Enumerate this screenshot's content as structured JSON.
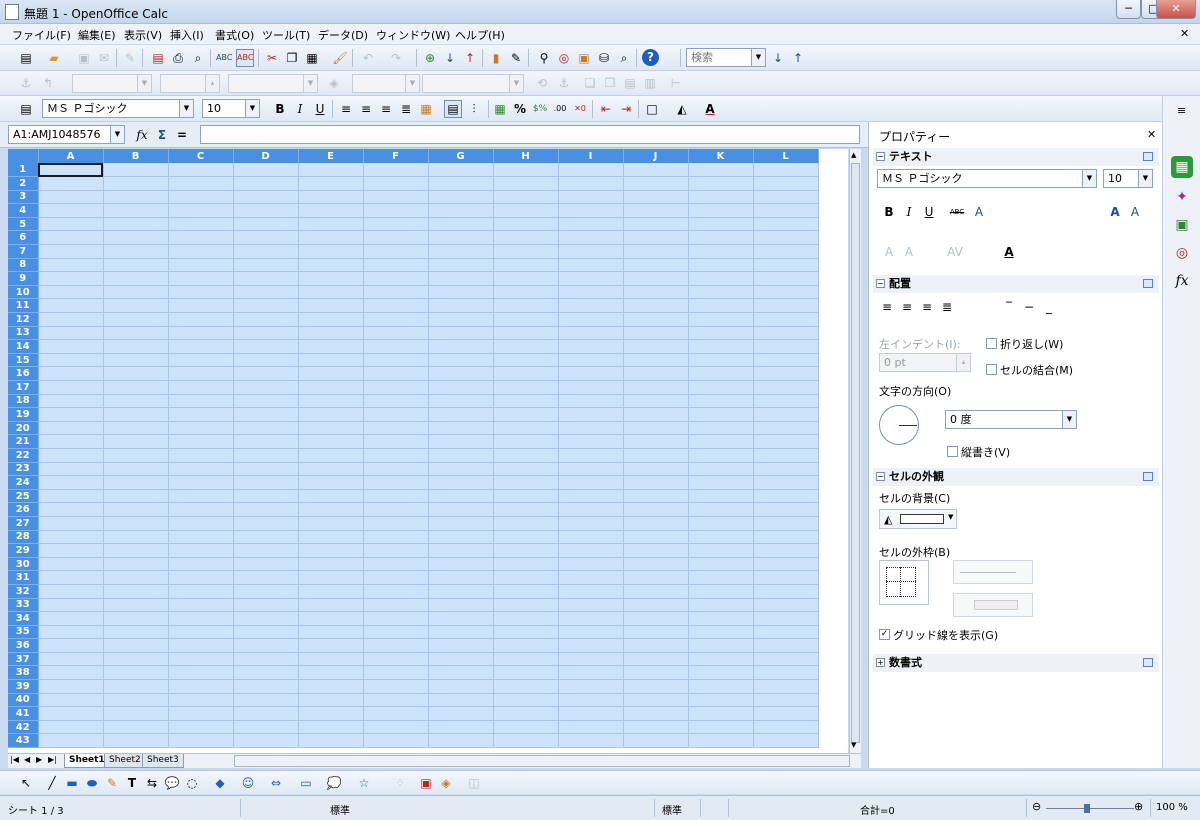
{
  "window": {
    "title": "無題 1 - OpenOffice Calc",
    "min": "─",
    "max": "□",
    "close": "✕",
    "doc_close": "✕"
  },
  "menu": [
    "ファイル(F)",
    "編集(E)",
    "表示(V)",
    "挿入(I)",
    "書式(O)",
    "ツール(T)",
    "データ(D)",
    "ウィンドウ(W)",
    "ヘルプ(H)"
  ],
  "search": {
    "placeholder": "検索",
    "value": "検索"
  },
  "format": {
    "font": "ＭＳ Ｐゴシック",
    "size": "10",
    "bold": "B",
    "italic": "I",
    "underline": "U",
    "percent": "%"
  },
  "formula": {
    "namebox": "A1:AMJ1048576",
    "fx": "fx",
    "sum": "Σ",
    "equals": "=",
    "value": ""
  },
  "grid": {
    "columns": [
      "A",
      "B",
      "C",
      "D",
      "E",
      "F",
      "G",
      "H",
      "I",
      "J",
      "K",
      "L"
    ],
    "rows": [
      "1",
      "2",
      "3",
      "4",
      "5",
      "6",
      "7",
      "8",
      "9",
      "10",
      "11",
      "12",
      "13",
      "14",
      "15",
      "16",
      "17",
      "18",
      "19",
      "20",
      "21",
      "22",
      "23",
      "24",
      "25",
      "26",
      "27",
      "28",
      "29",
      "30",
      "31",
      "32",
      "33",
      "34",
      "35",
      "36",
      "37",
      "38",
      "39",
      "40",
      "41",
      "42",
      "43"
    ]
  },
  "sheets": [
    "Sheet1",
    "Sheet2",
    "Sheet3"
  ],
  "status": {
    "sheet": "シート 1 / 3",
    "style": "標準",
    "mode": "標準",
    "sum": "合計=0",
    "zoom": "100 %",
    "zoom_minus": "⊖",
    "zoom_plus": "⊕"
  },
  "sidebar": {
    "title": "プロパティー",
    "close": "✕",
    "menu": "≡",
    "text": {
      "header": "テキスト",
      "font": "ＭＳ Ｐゴシック",
      "size": "10",
      "bold": "B",
      "italic": "I",
      "underline": "U",
      "strike": "ABC"
    },
    "align": {
      "header": "配置",
      "indent_label": "左インデント(I):",
      "indent_value": "0 pt",
      "wrap_label": "折り返し(W)",
      "merge_label": "セルの結合(M)",
      "direction_label": "文字の方向(O)",
      "angle": "0 度",
      "vertical_label": "縦書き(V)"
    },
    "appearance": {
      "header": "セルの外観",
      "background_label": "セルの背景(C)",
      "border_label": "セルの外枠(B)",
      "gridlines_label": "グリッド線を表示(G)",
      "gridlines_checked": true
    },
    "number": {
      "header": "数書式"
    }
  }
}
